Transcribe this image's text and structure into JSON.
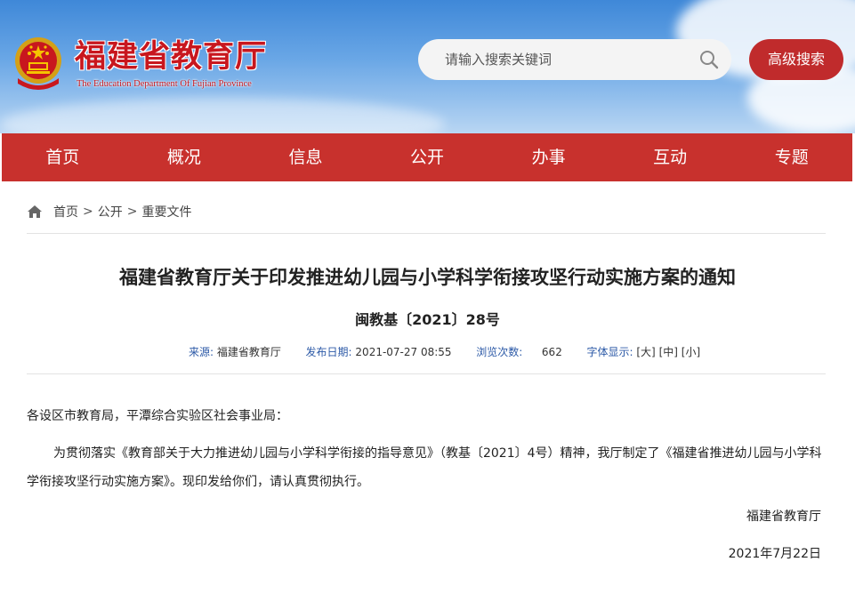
{
  "header": {
    "site_title": "福建省教育厅",
    "site_subtitle": "The Education Department Of Fujian Province",
    "search_placeholder": "请输入搜索关键词",
    "advanced_search_label": "高级搜索"
  },
  "nav": {
    "items": [
      "首页",
      "概况",
      "信息",
      "公开",
      "办事",
      "互动",
      "专题"
    ]
  },
  "breadcrumb": {
    "items": [
      "首页",
      "公开",
      "重要文件"
    ],
    "separator": ">"
  },
  "article": {
    "title": "福建省教育厅关于印发推进幼儿园与小学科学衔接攻坚行动实施方案的通知",
    "doc_number": "闽教基〔2021〕28号",
    "meta": {
      "source_label": "来源:",
      "source_value": "福建省教育厅",
      "date_label": "发布日期:",
      "date_value": "2021-07-27 08:55",
      "views_label": "浏览次数:",
      "views_value": "662",
      "font_label": "字体显示:",
      "font_large": "[大]",
      "font_medium": "[中]",
      "font_small": "[小]"
    },
    "salutation": "各设区市教育局，平潭综合实验区社会事业局：",
    "paragraph": "为贯彻落实《教育部关于大力推进幼儿园与小学科学衔接的指导意见》（教基〔2021〕4号）精神，我厅制定了《福建省推进幼儿园与小学科学衔接攻坚行动实施方案》。现印发给你们，请认真贯彻执行。",
    "signature": "福建省教育厅",
    "date": "2021年7月22日"
  },
  "colors": {
    "nav_bg": "#c8312d",
    "brand_red": "#c8171e",
    "meta_label_blue": "#2d5aa7"
  }
}
